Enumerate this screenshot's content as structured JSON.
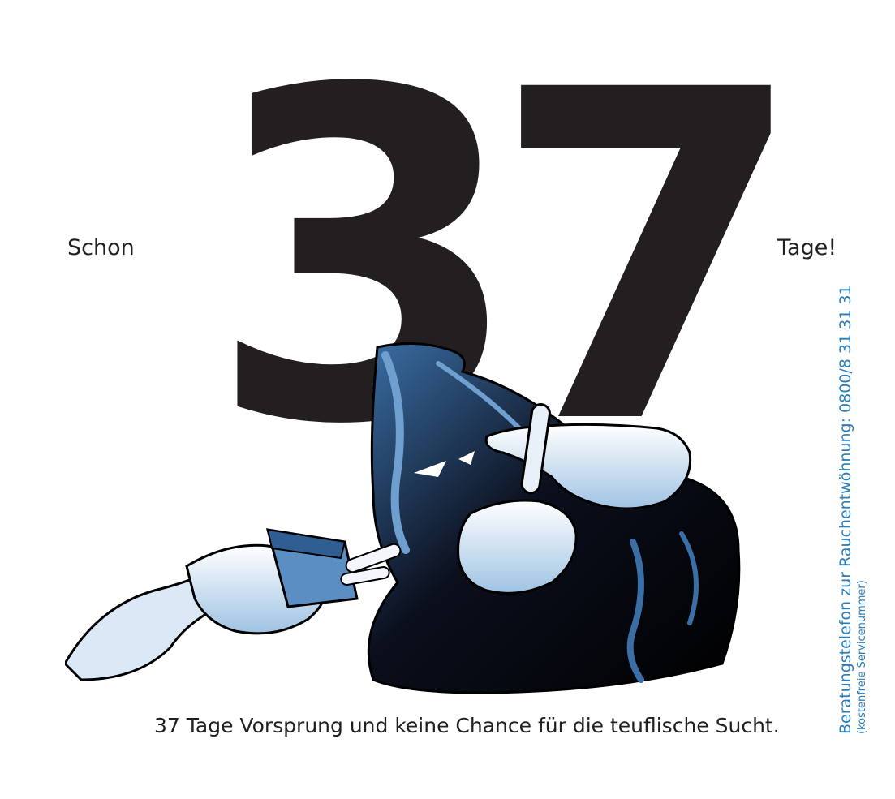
{
  "headline": {
    "prefix": "Schon",
    "number": "37",
    "suffix": "Tage!"
  },
  "caption": "37 Tage Vorsprung und keine Chance für die teuflische Sucht.",
  "hotline": {
    "label": "Beratungstelefon zur Rauchentwöhnung: 0800/8 31 31 31",
    "note": "(kostenfreie Servicenummer)"
  },
  "colors": {
    "text": "#231f20",
    "accent_blue": "#2a7db8",
    "illustration_blue": "#3a6ea5",
    "illustration_light": "#cfe0f0"
  },
  "illustration": {
    "icon": "hooded-devil-refusing-cigarette-icon"
  }
}
